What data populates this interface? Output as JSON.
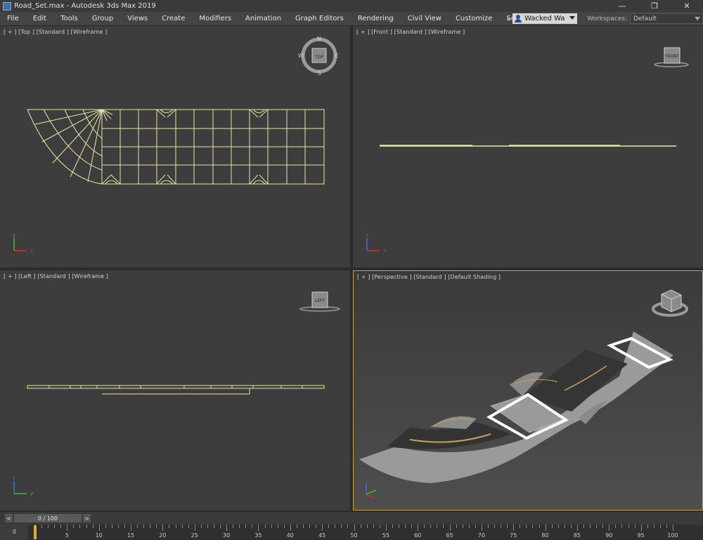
{
  "window": {
    "title": "Road_Set.max - Autodesk 3ds Max 2019",
    "minimize": "—",
    "maximize": "❒",
    "close": "✕"
  },
  "menu": [
    "File",
    "Edit",
    "Tools",
    "Group",
    "Views",
    "Create",
    "Modifiers",
    "Animation",
    "Graph Editors",
    "Rendering",
    "Civil View",
    "Customize",
    "Scripting"
  ],
  "toolbar": {
    "overflow": "»",
    "user": "Wacked Wa",
    "workspaces_label": "Workspaces:",
    "workspace_value": "Default"
  },
  "viewports": {
    "top": {
      "label": "[ + ] [Top ] [Standard ] [Wireframe ]",
      "cube": "TOP",
      "compass": {
        "n": "N",
        "s": "S",
        "e": "E",
        "w": "W"
      }
    },
    "front": {
      "label": "[ + ] [Front ] [Standard ] [Wireframe ]",
      "cube": "FRONT"
    },
    "left": {
      "label": "[ + ] [Left ] [Standard ] [Wireframe ]",
      "cube": "LEFT"
    },
    "perspective": {
      "label": "[ + ] [Perspective ] [Standard ] [Default Shading ]"
    }
  },
  "axes": {
    "x": "x",
    "y": "y",
    "z": "z"
  },
  "timeline": {
    "current": "0 / 100",
    "prev": "<",
    "next": ">",
    "ruler_end": "0",
    "ticks": [
      "0",
      "5",
      "10",
      "15",
      "20",
      "25",
      "30",
      "35",
      "40",
      "45",
      "50",
      "55",
      "60",
      "65",
      "70",
      "75",
      "80",
      "85",
      "90",
      "95",
      "100"
    ]
  },
  "colors": {
    "wireframe": "#e8e8a0",
    "active_border": "#c8a63a",
    "viewport_bg": "#3d3d3d",
    "road_surface": "#9a9a9a",
    "asphalt": "#3a3a3a"
  }
}
